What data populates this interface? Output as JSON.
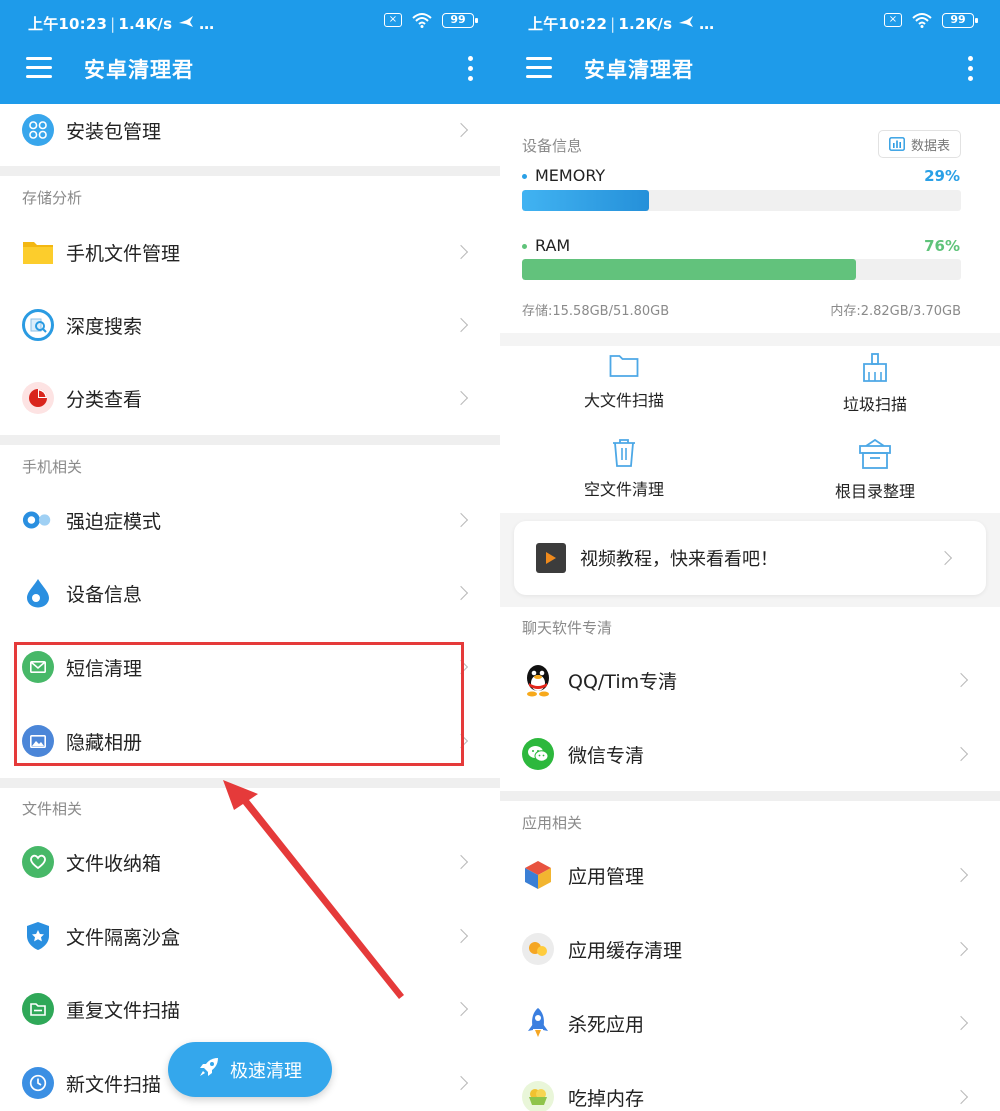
{
  "left": {
    "status": {
      "time": "上午10:23",
      "speed": "1.4K/s",
      "extra": "…",
      "battery": "99"
    },
    "title": "安卓清理君",
    "top_item": "安装包管理",
    "sections": [
      {
        "title": "存储分析",
        "items": [
          "手机文件管理",
          "深度搜索",
          "分类查看"
        ]
      },
      {
        "title": "手机相关",
        "items": [
          "强迫症模式",
          "设备信息",
          "短信清理",
          "隐藏相册"
        ]
      },
      {
        "title": "文件相关",
        "items": [
          "文件收纳箱",
          "文件隔离沙盒",
          "重复文件扫描",
          "新文件扫描"
        ]
      }
    ],
    "fab": "极速清理"
  },
  "right": {
    "status": {
      "time": "上午10:22",
      "speed": "1.2K/s",
      "extra": "…",
      "battery": "99"
    },
    "title": "安卓清理君",
    "device": {
      "title": "设备信息",
      "datatable": "数据表",
      "memory": {
        "label": "MEMORY",
        "percent_text": "29%",
        "percent": 29,
        "color": "#2aa0e6"
      },
      "ram": {
        "label": "RAM",
        "percent_text": "76%",
        "percent": 76,
        "color": "#5fc37a"
      },
      "storage": "存储:15.58GB/51.80GB",
      "mem": "内存:2.82GB/3.70GB"
    },
    "tools": [
      "大文件扫描",
      "垃圾扫描",
      "空文件清理",
      "根目录整理"
    ],
    "video": "视频教程，快来看看吧！",
    "chat": {
      "title": "聊天软件专清",
      "items": [
        "QQ/Tim专清",
        "微信专清"
      ]
    },
    "apps": {
      "title": "应用相关",
      "items": [
        "应用管理",
        "应用缓存清理",
        "杀死应用",
        "吃掉内存"
      ]
    }
  }
}
